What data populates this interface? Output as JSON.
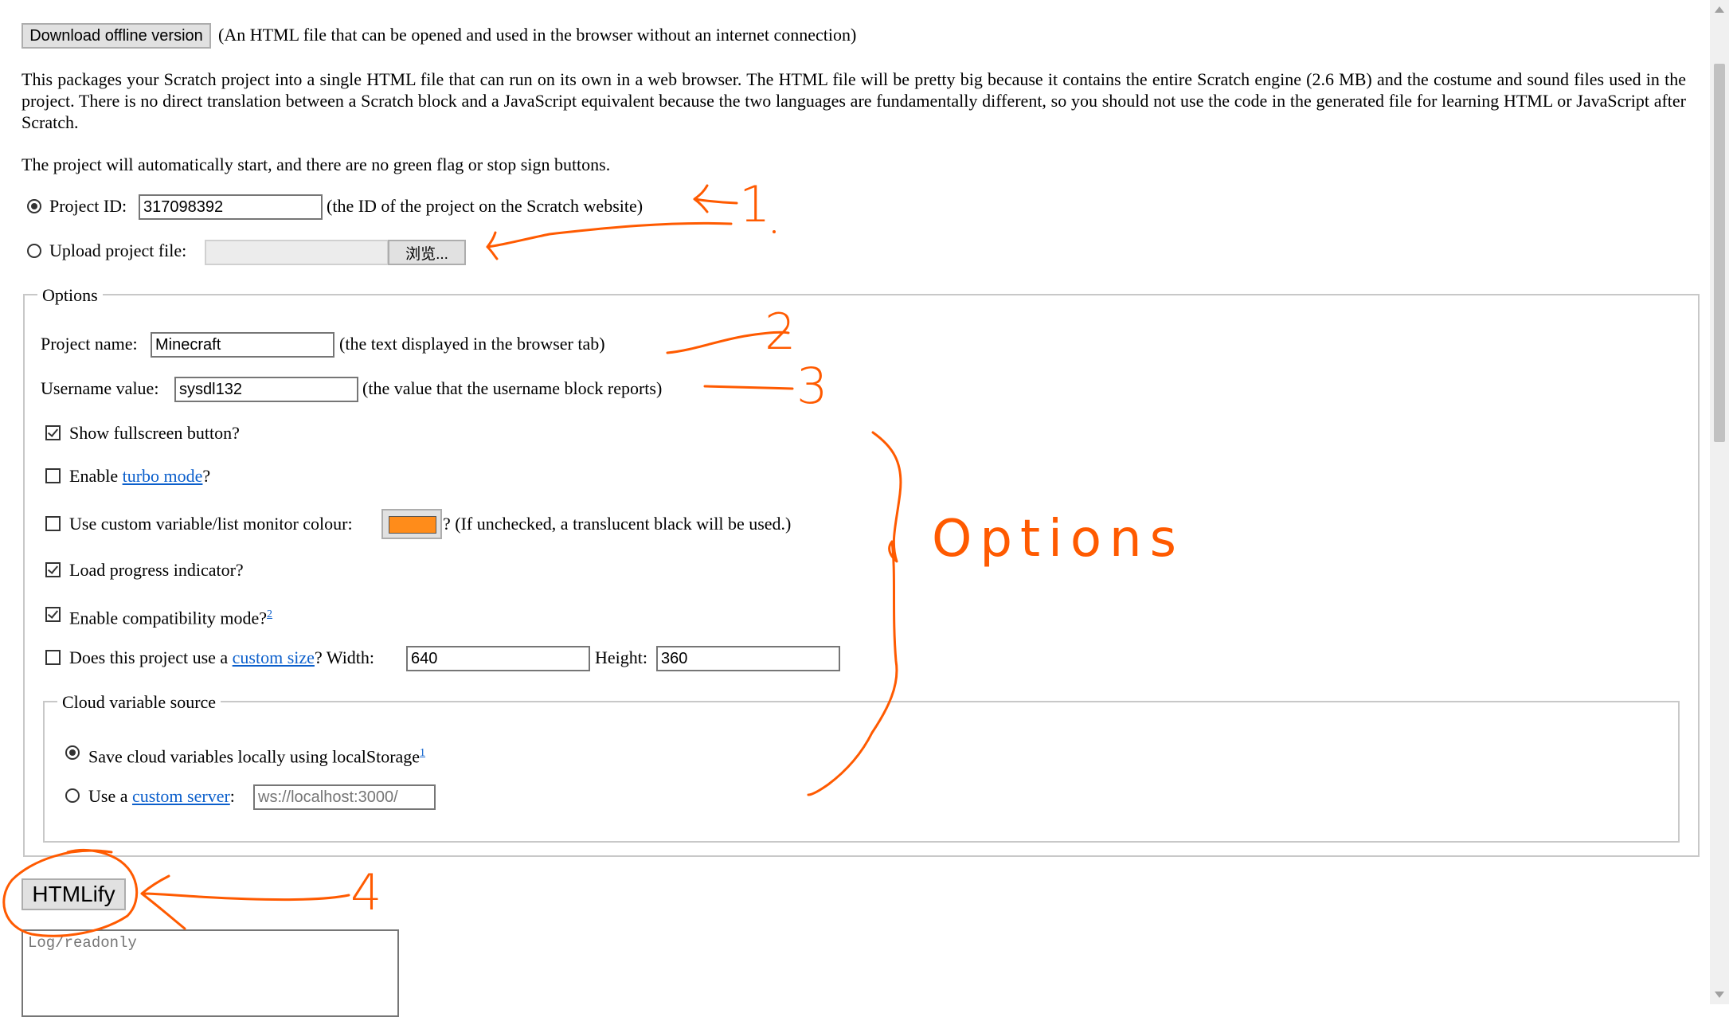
{
  "top": {
    "download_button": "Download offline version",
    "download_note": "(An HTML file that can be opened and used in the browser without an internet connection)"
  },
  "intro": {
    "paragraph": "This packages your Scratch project into a single HTML file that can run on its own in a web browser. The HTML file will be pretty big because it contains the entire Scratch engine (2.6 MB) and the costume and sound files used in the project. There is no direct translation between a Scratch block and a JavaScript equivalent because the two languages are fundamentally different, so you should not use the code in the generated file for learning HTML or JavaScript after Scratch.",
    "autostart_note": "The project will automatically start, and there are no green flag or stop sign buttons."
  },
  "source": {
    "project_id_label": "Project ID:",
    "project_id_value": "317098392",
    "project_id_note": "(the ID of the project on the Scratch website)",
    "upload_label": "Upload project file:",
    "browse_button": "浏览...",
    "selected": "project_id"
  },
  "options": {
    "legend": "Options",
    "project_name_label": "Project name:",
    "project_name_value": "Minecraft",
    "project_name_note": "(the text displayed in the browser tab)",
    "username_label": "Username value:",
    "username_value": "sysdl132",
    "username_note": "(the value that the username block reports)",
    "fullscreen_label": "Show fullscreen button?",
    "fullscreen_checked": true,
    "turbo_prefix": "Enable",
    "turbo_link": "turbo mode",
    "turbo_suffix": "?",
    "turbo_checked": false,
    "monitor_label": "Use custom variable/list monitor colour:",
    "monitor_color": "#ff8c1a",
    "monitor_note": "? (If unchecked, a translucent black will be used.)",
    "monitor_checked": false,
    "progress_label": "Load progress indicator?",
    "progress_checked": true,
    "compat_label": "Enable compatibility mode?",
    "compat_sup": "2",
    "compat_checked": true,
    "size_prefix": "Does this project use a",
    "size_link": "custom size",
    "size_width_label": "? Width:",
    "size_width_value": "640",
    "size_height_label": "Height:",
    "size_height_value": "360",
    "size_checked": false
  },
  "cloud": {
    "legend": "Cloud variable source",
    "local_label": "Save cloud variables locally using localStorage",
    "local_sup": "1",
    "server_prefix": "Use a",
    "server_link": "custom server",
    "server_colon": ":",
    "server_placeholder": "ws://localhost:3000/",
    "selected": "local"
  },
  "actions": {
    "htmlify_button": "HTMLify",
    "log_placeholder": "Log/readonly"
  },
  "annotations": {
    "label_1": "1",
    "label_2": "2",
    "label_3": "3",
    "label_4": "4",
    "options_label": "Options",
    "color": "#ff5a00"
  }
}
